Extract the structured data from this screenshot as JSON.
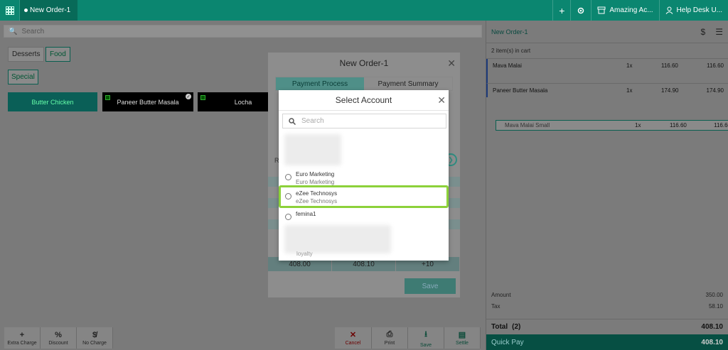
{
  "topbar": {
    "tab_label": "New Order-1",
    "add_symbol": "+",
    "outlet_label": "Amazing Ac...",
    "user_label": "Help Desk U..."
  },
  "left": {
    "search_placeholder": "Search",
    "categories": [
      "Desserts",
      "Food"
    ],
    "subcategory": "Special",
    "items": [
      "Butter Chicken",
      "Paneer Butter Masala",
      "Locha"
    ],
    "actions": {
      "extra_charge": "Extra Charge",
      "discount": "Discount",
      "no_charge": "No Charge",
      "cancel": "Cancel",
      "print": "Print",
      "save": "Save",
      "settle": "Settle"
    }
  },
  "cart": {
    "order_name": "New Order-1",
    "count_text": "2 item(s) in cart",
    "rows": [
      {
        "name": "Mava Malai",
        "qty": "1x",
        "price": "116.60",
        "total": "116.60"
      },
      {
        "name": "Mava Malai Small",
        "qty": "1x",
        "price": "116.60",
        "total": "116.60"
      },
      {
        "name": "Paneer Butter Masala",
        "qty": "1x",
        "price": "174.90",
        "total": "174.90"
      }
    ],
    "amount_label": "Amount",
    "amount_value": "350.00",
    "tax_label": "Tax",
    "tax_value": "58.10",
    "total_label": "Total",
    "total_count": "(2)",
    "total_value": "408.10",
    "quickpay_label": "Quick Pay",
    "quickpay_value": "408.10"
  },
  "payment_modal": {
    "title": "New Order-1",
    "tabs": [
      "Payment Process",
      "Payment Summary"
    ],
    "row": [
      "408.00",
      "408.10",
      "+10"
    ],
    "save_label": "Save",
    "partial_label": "R"
  },
  "select_account": {
    "title": "Select Account",
    "search_placeholder": "Search",
    "options": [
      {
        "name": "Euro Marketing",
        "sub": "Euro Marketing"
      },
      {
        "name": "eZee Technosys",
        "sub": "eZee Technosys"
      },
      {
        "name": "femina1",
        "sub": ""
      }
    ],
    "partial_text": "loyalty"
  }
}
